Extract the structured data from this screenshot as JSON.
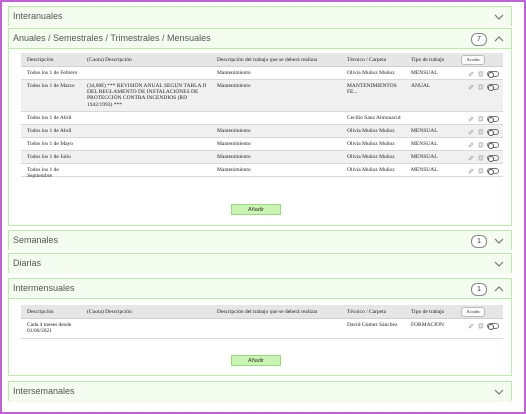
{
  "panels": {
    "interanuales": {
      "title": "Interanuales"
    },
    "anuales": {
      "title": "Anuales / Semestrales / Trimestrales / Mensuales",
      "count": "7",
      "add_label": "Añadir"
    },
    "semanales": {
      "title": "Semanales",
      "count": "1"
    },
    "diarias": {
      "title": "Diarias"
    },
    "intermensuales": {
      "title": "Intermensuales",
      "count": "1",
      "add_label": "Añadir"
    },
    "intersemanales": {
      "title": "Intersemanales"
    }
  },
  "table_headers": {
    "descripcion": "Descripción",
    "cuota": "(Cuota) Descripción",
    "trabajo": "Descripción del trabajo que se deberá realizar",
    "tecnico": "Técnico / Carpeta",
    "tipo": "Tipo de trabajo",
    "acciones": "Acción"
  },
  "anuales_rows": [
    {
      "descripcion": "Todos los 1 de Febrero",
      "cuota": "",
      "trabajo": "Mantenimiento",
      "tecnico": "Olivia Muñoz Muñoz",
      "tipo": "MENSUAL"
    },
    {
      "descripcion": "Todos los 1 de Marzo",
      "cuota": "(34,00€) *** REVISIÓN ANUAL SEGÚN TABLA II DEL REGLAMENTO DE INSTALACIONES DE PROTECCIÓN CONTRA INCENDIOS (RD 1942/1993) ***",
      "trabajo": "Mantenimiento",
      "tecnico": "MANTENIMIENTOS FE...",
      "tipo": "ANUAL"
    },
    {
      "descripcion": "Todos los 1 de Abril",
      "cuota": "",
      "trabajo": "",
      "tecnico": "Cecilio Sanz Almonacid",
      "tipo": ""
    },
    {
      "descripcion": "Todos los 1 de Abril",
      "cuota": "",
      "trabajo": "Mantenimiento",
      "tecnico": "Olivia Muñoz Muñoz",
      "tipo": "MENSUAL"
    },
    {
      "descripcion": "Todos los 1 de Mayo",
      "cuota": "",
      "trabajo": "Mantenimiento",
      "tecnico": "Olivia Muñoz Muñoz",
      "tipo": "MENSUAL"
    },
    {
      "descripcion": "Todos los 1 de Julio",
      "cuota": "",
      "trabajo": "Mantenimiento",
      "tecnico": "Olivia Muñoz Muñoz",
      "tipo": "MENSUAL"
    },
    {
      "descripcion": "Todos los 1 de Septiembre",
      "cuota": "",
      "trabajo": "Mantenimiento",
      "tecnico": "Olivia Muñoz Muñoz",
      "tipo": "MENSUAL"
    }
  ],
  "intermensuales_rows": [
    {
      "descripcion": "Cada 4 meses desde 01/06/2021",
      "cuota": "",
      "trabajo": "",
      "tecnico": "David Gómez Sánchez",
      "tipo": "FORMACIÓN"
    }
  ],
  "colors": {
    "accent_green": "#b9eea6",
    "button_green": "#c9f5b3",
    "frame": "#c061d6"
  },
  "icons": [
    "chevron-down-icon",
    "chevron-up-icon",
    "edit-icon",
    "copy-icon",
    "toggle-switch"
  ]
}
